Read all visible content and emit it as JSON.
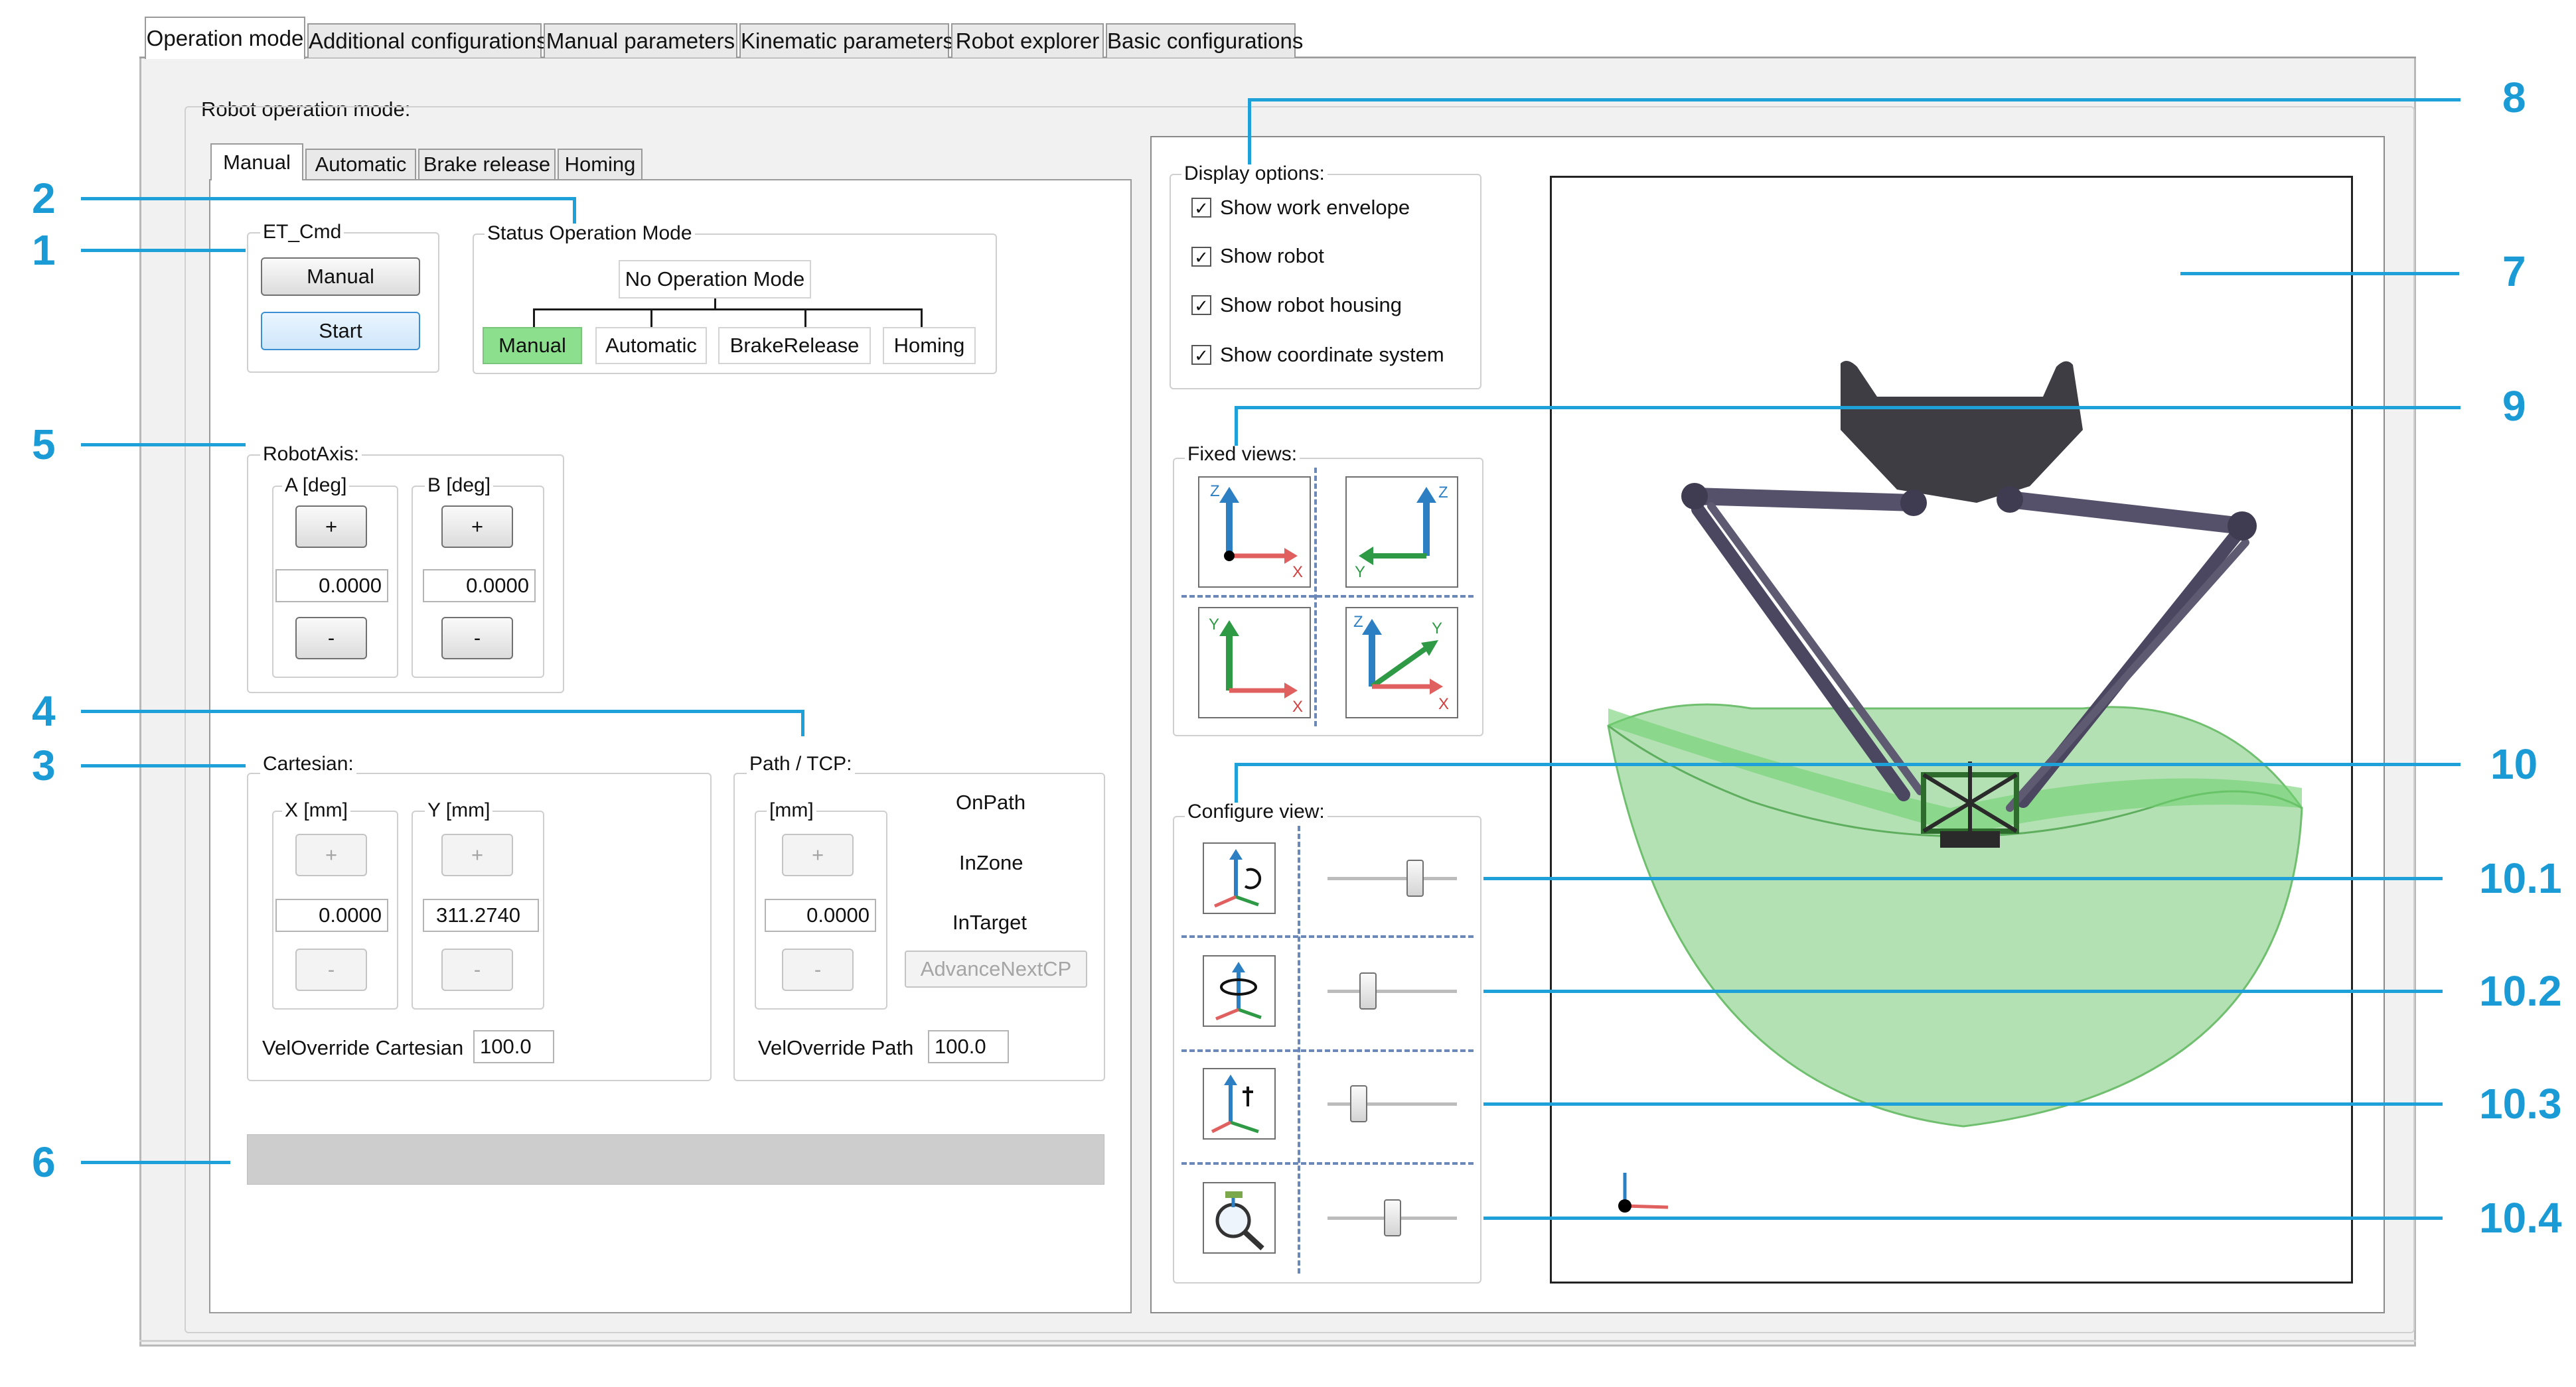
{
  "tabs": [
    "Operation mode",
    "Additional configurations",
    "Manual parameters",
    "Kinematic parameters",
    "Robot explorer",
    "Basic configurations"
  ],
  "robot_operation_mode_label": "Robot operation mode:",
  "mode_tabs": [
    "Manual",
    "Automatic",
    "Brake release",
    "Homing"
  ],
  "et_cmd": {
    "label": "ET_Cmd",
    "manual_button": "Manual",
    "start_button": "Start"
  },
  "status": {
    "label": "Status Operation Mode",
    "current": "No Operation Mode",
    "modes": [
      "Manual",
      "Automatic",
      "BrakeRelease",
      "Homing"
    ]
  },
  "robot_axis": {
    "label": "RobotAxis:",
    "a": {
      "label": "A [deg]",
      "plus": "+",
      "value": "0.0000",
      "minus": "-"
    },
    "b": {
      "label": "B [deg]",
      "plus": "+",
      "value": "0.0000",
      "minus": "-"
    }
  },
  "cartesian": {
    "label": "Cartesian:",
    "x": {
      "label": "X [mm]",
      "plus": "+",
      "value": "0.0000",
      "minus": "-"
    },
    "y": {
      "label": "Y [mm]",
      "plus": "+",
      "value": "311.2740",
      "minus": "-"
    },
    "vel_label": "VelOverride Cartesian",
    "vel_value": "100.0"
  },
  "path": {
    "label": "Path / TCP:",
    "mm": {
      "label": "[mm]",
      "plus": "+",
      "value": "0.0000",
      "minus": "-"
    },
    "on_path": "OnPath",
    "in_zone": "InZone",
    "in_target": "InTarget",
    "advance_button": "AdvanceNextCP",
    "vel_label": "VelOverride Path",
    "vel_value": "100.0"
  },
  "display_options": {
    "label": "Display options:",
    "items": [
      {
        "label": "Show work envelope",
        "checked": true
      },
      {
        "label": "Show robot",
        "checked": true
      },
      {
        "label": "Show robot housing",
        "checked": true
      },
      {
        "label": "Show coordinate system",
        "checked": true
      }
    ]
  },
  "fixed_views": {
    "label": "Fixed views:",
    "views": [
      [
        "Z",
        "X"
      ],
      [
        "Z",
        "Y"
      ],
      [
        "Y",
        "X"
      ],
      [
        "Z",
        "Y",
        "X"
      ]
    ]
  },
  "configure_view": {
    "label": "Configure view:",
    "slider_levels": [
      0.7,
      0.28,
      0.2,
      0.5
    ]
  },
  "callouts": [
    "1",
    "2",
    "3",
    "4",
    "5",
    "6",
    "7",
    "8",
    "9",
    "10",
    "10.1",
    "10.2",
    "10.3",
    "10.4"
  ],
  "colors": {
    "accent": "#1a9bd6",
    "active_mode": "#8cdf8c",
    "envelope": "#79d279"
  }
}
